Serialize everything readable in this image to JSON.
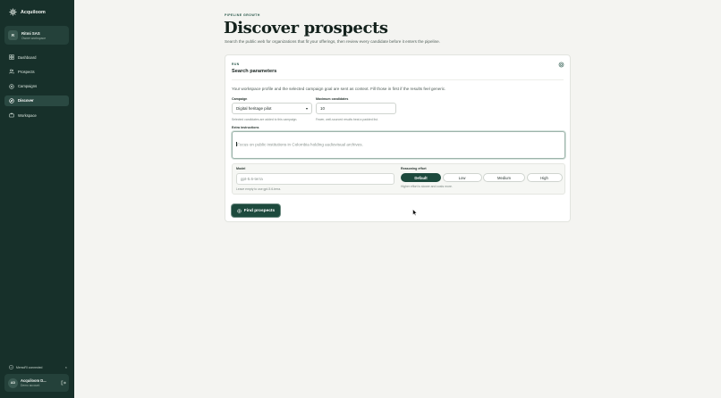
{
  "brand": {
    "name": "Acquiloom"
  },
  "workspace": {
    "initial": "R",
    "name": "Ritmi SAS",
    "role": "Owner workspace"
  },
  "nav": {
    "items": [
      {
        "label": "Dashboard",
        "icon": "grid-icon",
        "active": false
      },
      {
        "label": "Prospects",
        "icon": "users-icon",
        "active": false
      },
      {
        "label": "Campaigns",
        "icon": "megaphone-icon",
        "active": false
      },
      {
        "label": "Discover",
        "icon": "compass-icon",
        "active": true
      },
      {
        "label": "Workspace",
        "icon": "briefcase-icon",
        "active": false
      }
    ]
  },
  "mcp": {
    "label": "MemoRI connected"
  },
  "user": {
    "initials": "AD",
    "name": "Acquiloom D...",
    "sub": "Demo account"
  },
  "page": {
    "eyebrow": "PIPELINE GROWTH",
    "title": "Discover prospects",
    "subtitle": "Search the public web for organizations that fit your offerings, then review every candidate before it enters the pipeline."
  },
  "card": {
    "eyebrow": "RUN",
    "title": "Search parameters",
    "description": "Your workspace profile and the selected campaign goal are sent as context. Fill those in first if the results feel generic.",
    "campaign": {
      "label": "Campaign",
      "value": "Digital heritage pilot",
      "help": "Selected candidates are added to this campaign."
    },
    "max_candidates": {
      "label": "Maximum candidates",
      "value": "10",
      "help": "Fewer, well-sourced results beat a padded list."
    },
    "extra": {
      "label": "Extra instructions",
      "placeholder": "Focus on public institutions in Colombia holding audiovisual archives."
    },
    "model": {
      "label": "Model",
      "placeholder": "gpt-5.6-terra",
      "help": "Leave empty to use gpt-5.6-terra."
    },
    "reasoning": {
      "label": "Reasoning effort",
      "options": [
        "Default",
        "Low",
        "Medium",
        "High"
      ],
      "selected": "Default",
      "help": "Higher effort is slower and costs more."
    },
    "submit_label": "Find prospects"
  },
  "colors": {
    "sidebar": "#17302a",
    "accent": "#1d4a3d",
    "background": "#f4f4f1"
  }
}
